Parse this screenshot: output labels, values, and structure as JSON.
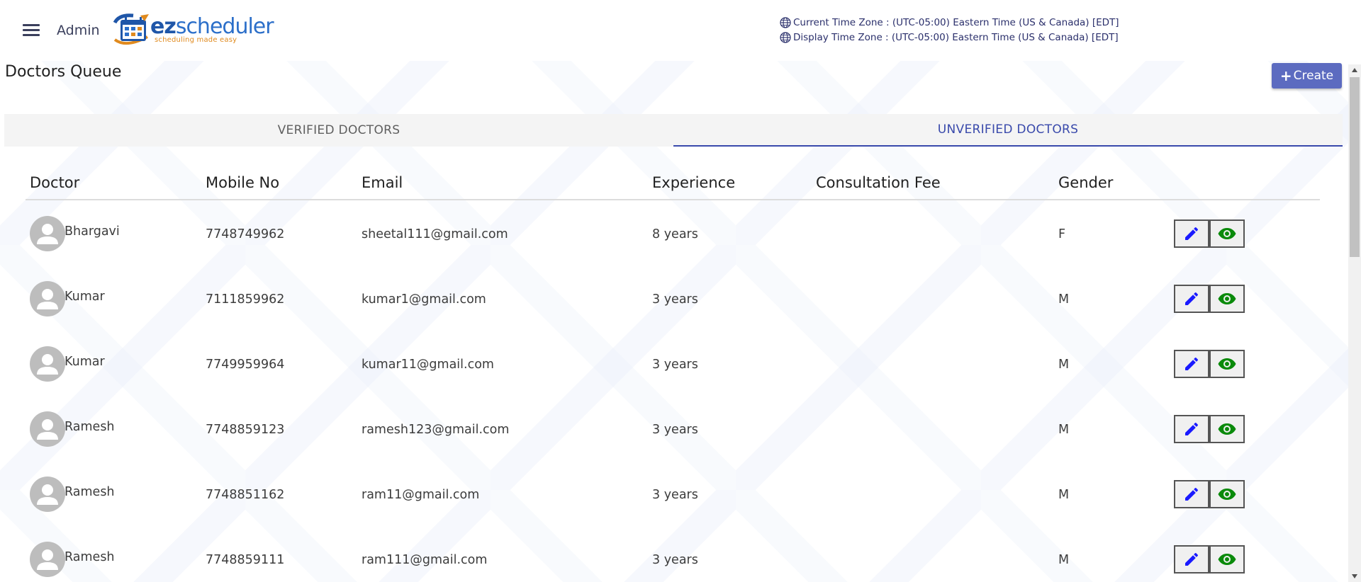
{
  "header": {
    "role_label": "Admin",
    "logo": {
      "text_ez": "ez",
      "text_scheduler": "scheduler",
      "tagline": "scheduling made easy"
    },
    "current_time_zone": "Current Time Zone : (UTC-05:00) Eastern Time (US & Canada) [EDT]",
    "display_time_zone": "Display Time Zone : (UTC-05:00) Eastern Time (US & Canada) [EDT]"
  },
  "page": {
    "title": "Doctors Queue",
    "create_label": "Create",
    "create_plus": "+"
  },
  "tabs": [
    {
      "label": "VERIFIED DOCTORS",
      "active": false
    },
    {
      "label": "UNVERIFIED DOCTORS",
      "active": true
    }
  ],
  "table": {
    "columns": [
      "Doctor",
      "Mobile No",
      "Email",
      "Experience",
      "Consultation Fee",
      "Gender"
    ],
    "rows": [
      {
        "doctor": "Bhargavi",
        "mobile": "7748749962",
        "email": "sheetal111@gmail.com",
        "experience": "8 years",
        "fee": "",
        "gender": "F"
      },
      {
        "doctor": "Kumar",
        "mobile": "7111859962",
        "email": "kumar1@gmail.com",
        "experience": "3 years",
        "fee": "",
        "gender": "M"
      },
      {
        "doctor": "Kumar",
        "mobile": "7749959964",
        "email": "kumar11@gmail.com",
        "experience": "3 years",
        "fee": "",
        "gender": "M"
      },
      {
        "doctor": "Ramesh",
        "mobile": "7748859123",
        "email": "ramesh123@gmail.com",
        "experience": "3 years",
        "fee": "",
        "gender": "M"
      },
      {
        "doctor": "Ramesh",
        "mobile": "7748851162",
        "email": "ram11@gmail.com",
        "experience": "3 years",
        "fee": "",
        "gender": "M"
      },
      {
        "doctor": "Ramesh",
        "mobile": "7748859111",
        "email": "ram111@gmail.com",
        "experience": "3 years",
        "fee": "",
        "gender": "M"
      }
    ]
  },
  "icons": {
    "menu": "menu-icon",
    "globe": "globe-icon",
    "avatar": "person-icon",
    "edit": "pencil-icon",
    "view": "eye-icon"
  },
  "colors": {
    "primary": "#5c6bc0",
    "active_tab": "#3949ab",
    "edit_icon": "#1a1aff",
    "view_icon": "#0a8a0a",
    "logo_blue": "#1f56a8",
    "logo_orange": "#e08a1e"
  }
}
